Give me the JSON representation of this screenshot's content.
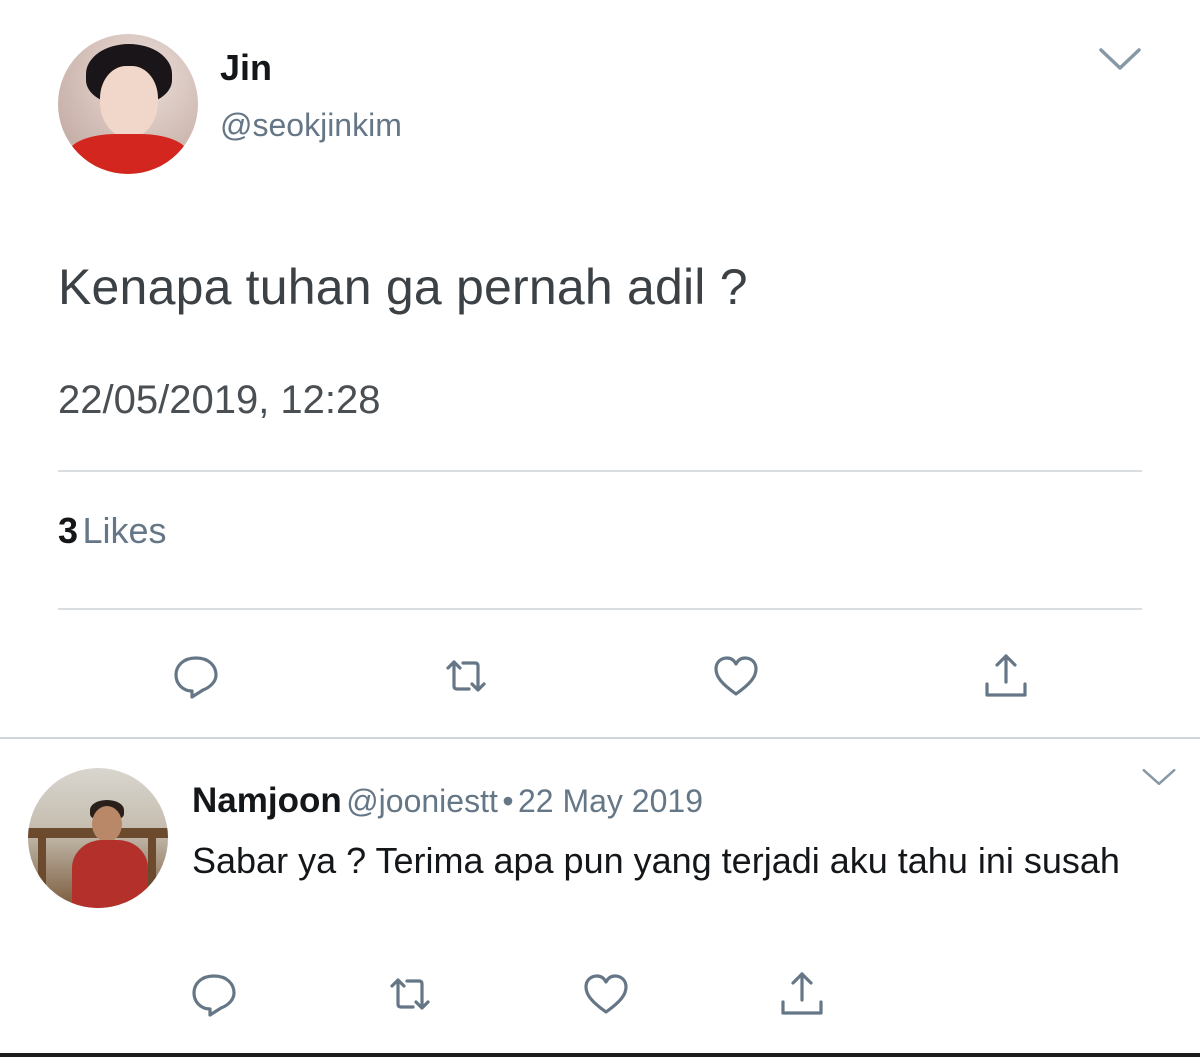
{
  "tweet": {
    "author_name": "Jin",
    "author_handle": "@seokjinkim",
    "text": "Kenapa tuhan ga pernah adil ?",
    "timestamp": "22/05/2019, 12:28",
    "likes_count": "3",
    "likes_label": "Likes",
    "actions": [
      "reply-icon",
      "retweet-icon",
      "like-icon",
      "share-icon"
    ],
    "menu_icon": "chevron-down-icon"
  },
  "reply": {
    "author_name": "Namjoon",
    "author_handle": "@jooniestt",
    "separator": "•",
    "date": "22 May 2019",
    "text": "Sabar ya ? Terima apa pun yang terjadi aku tahu ini susah",
    "actions": [
      "reply-icon",
      "retweet-icon",
      "like-icon",
      "share-icon"
    ],
    "menu_icon": "chevron-down-icon"
  },
  "colors": {
    "text_primary": "#14171a",
    "text_secondary": "#657786",
    "icon": "#657786",
    "divider": "#d9dde0"
  }
}
